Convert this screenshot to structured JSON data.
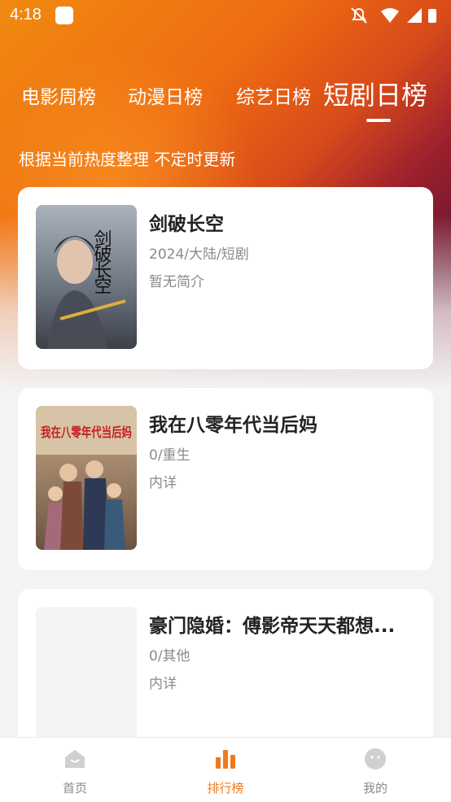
{
  "status_bar": {
    "time": "4:18"
  },
  "tabs": [
    {
      "label": "电影周榜"
    },
    {
      "label": "动漫日榜"
    },
    {
      "label": "综艺日榜"
    },
    {
      "label": "短剧日榜"
    }
  ],
  "subtitle": "根据当前热度整理 不定时更新",
  "cards": [
    {
      "title": "剑破长空",
      "meta": "2024/大陆/短剧",
      "desc": "暂无简介",
      "poster_text": "剑破长空"
    },
    {
      "title": "我在八零年代当后妈",
      "meta": "0/重生",
      "desc": "内详",
      "poster_text": "我在八零年代当后妈"
    },
    {
      "title": "豪门隐婚：傅影帝天天都想...",
      "meta": "0/其他",
      "desc": "内详"
    }
  ],
  "bottom_nav": [
    {
      "label": "首页"
    },
    {
      "label": "排行榜"
    },
    {
      "label": "我的"
    }
  ],
  "colors": {
    "accent": "#f07a1a",
    "hero_orange": "#ef6c12",
    "hero_dark": "#7a1c2a"
  }
}
